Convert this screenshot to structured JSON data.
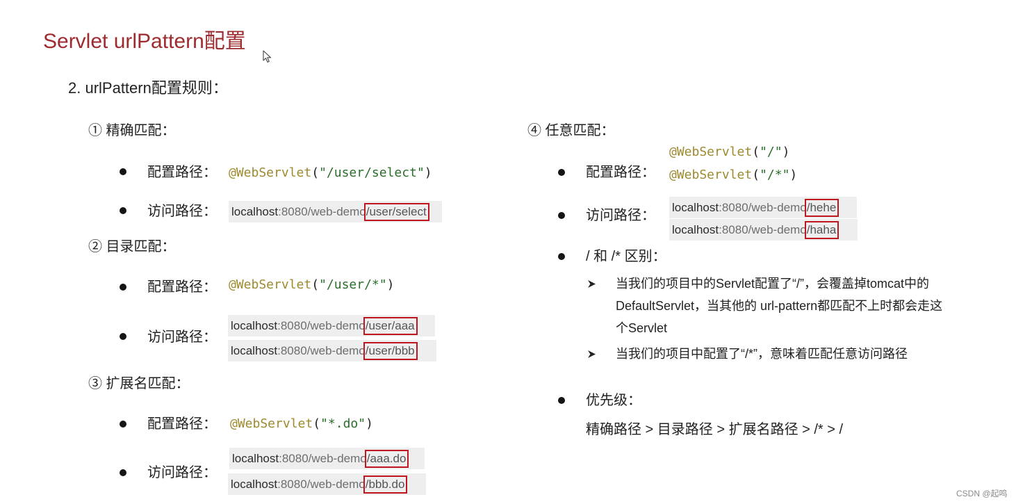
{
  "slide": {
    "title": "Servlet urlPattern配置",
    "subtitle": "2. urlPattern配置规则：",
    "watermark": "CSDN @起鸣"
  },
  "colors": {
    "title": "#9e2b2f",
    "annotation": "#9d8a2f",
    "string": "#2a6e2a",
    "highlight_border": "#c0161f",
    "url_background": "#eeeeee"
  },
  "icons": {
    "bullet": "bullet-icon",
    "arrow_bullet": "arrow-bullet-icon",
    "cursor": "mouse-cursor-icon"
  },
  "syntax": {
    "lparen": "(",
    "rparen": ")"
  },
  "exact": {
    "heading": "① 精确匹配：",
    "config_label": "配置路径：",
    "code": [
      {
        "annotation": "@WebServlet",
        "value": "\"/user/select\""
      }
    ],
    "access_label": "访问路径：",
    "urls": [
      {
        "host": "localhost",
        "base": ":8080/web-demo",
        "path": "/user/select"
      }
    ]
  },
  "directory": {
    "heading": "② 目录匹配：",
    "config_label": "配置路径：",
    "code": [
      {
        "annotation": "@WebServlet",
        "value": "\"/user/*\""
      }
    ],
    "access_label": "访问路径：",
    "urls": [
      {
        "host": "localhost",
        "base": ":8080/web-demo",
        "path": "/user/aaa"
      },
      {
        "host": "localhost",
        "base": ":8080/web-demo",
        "path": "/user/bbb"
      }
    ]
  },
  "extension": {
    "heading": "③ 扩展名匹配：",
    "config_label": "配置路径：",
    "code": [
      {
        "annotation": "@WebServlet",
        "value": "\"*.do\""
      }
    ],
    "access_label": "访问路径：",
    "urls": [
      {
        "host": "localhost",
        "base": ":8080/web-demo",
        "path": "/aaa.do"
      },
      {
        "host": "localhost",
        "base": ":8080/web-demo",
        "path": "/bbb.do"
      }
    ]
  },
  "any": {
    "heading": "④ 任意匹配：",
    "config_label": "配置路径：",
    "code": [
      {
        "annotation": "@WebServlet",
        "value": "\"/\""
      },
      {
        "annotation": "@WebServlet",
        "value": "\"/*\""
      }
    ],
    "access_label": "访问路径：",
    "urls": [
      {
        "host": "localhost",
        "base": ":8080/web-demo",
        "path": "/hehe"
      },
      {
        "host": "localhost",
        "base": ":8080/web-demo",
        "path": "/haha"
      }
    ],
    "difference": {
      "label": "/ 和 /* 区别：",
      "points": [
        {
          "lines": [
            "当我们的项目中的Servlet配置了“/”，会覆盖掉tomcat中的",
            "DefaultServlet，当其他的 url-pattern都匹配不上时都会走这",
            "个Servlet"
          ]
        },
        {
          "lines": [
            "当我们的项目中配置了“/*”，意味着匹配任意访问路径"
          ]
        }
      ]
    },
    "priority": {
      "label": "优先级：",
      "value": "精确路径 > 目录路径 > 扩展名路径 > /* > /"
    }
  }
}
